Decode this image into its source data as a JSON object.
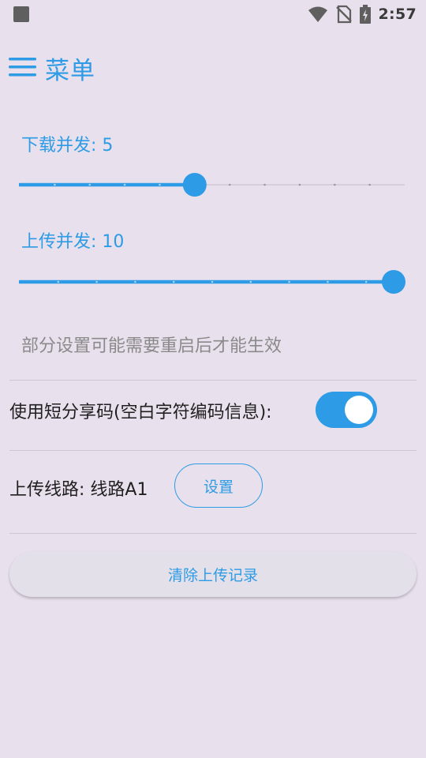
{
  "status_bar": {
    "time": "2:57",
    "icons": [
      "notification-square-icon",
      "wifi-icon",
      "no-sim-icon",
      "battery-charging-icon"
    ]
  },
  "app_bar": {
    "title": "菜单",
    "menu_icon": "menu-icon"
  },
  "download_concurrency": {
    "label": "下载并发: 5",
    "value": 5,
    "min": 0,
    "max": 11
  },
  "upload_concurrency": {
    "label": "上传并发: 10",
    "value": 10,
    "min": 0,
    "max": 10
  },
  "note": "部分设置可能需要重启后才能生效",
  "short_code": {
    "label": "使用短分享码(空白字符编码信息):",
    "enabled": true
  },
  "upload_route": {
    "label": "上传线路: 线路A1",
    "button": "设置"
  },
  "clear_button": "清除上传记录",
  "colors": {
    "accent": "#2d9be6",
    "background": "#e8e0ec",
    "track_inactive": "#d6cfdb",
    "note_text": "#8a8a8a"
  }
}
